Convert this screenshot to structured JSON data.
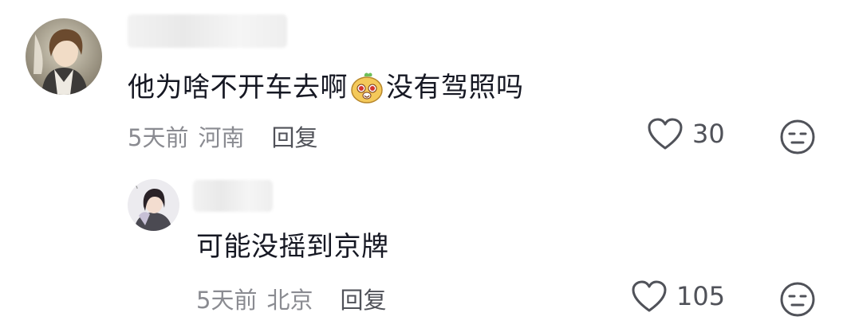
{
  "comments": [
    {
      "author_avatar": "avatar",
      "text_before_emoji": "他为啥不开车去啊",
      "emoji": "cute-face-emoji-icon",
      "text_after_emoji": "没有驾照吗",
      "time": "5天前",
      "location": "河南",
      "reply_label": "回复",
      "likes": "30",
      "like_icon": "heart-icon",
      "dislike_icon": "neutral-face-icon"
    }
  ],
  "replies": [
    {
      "author_avatar": "avatar",
      "text": "可能没摇到京牌",
      "time": "5天前",
      "location": "北京",
      "reply_label": "回复",
      "likes": "105",
      "like_icon": "heart-icon",
      "dislike_icon": "neutral-face-icon"
    }
  ],
  "colors": {
    "primary_text": "#161823",
    "secondary_text": "#8a8b91",
    "action_text": "#505259"
  }
}
